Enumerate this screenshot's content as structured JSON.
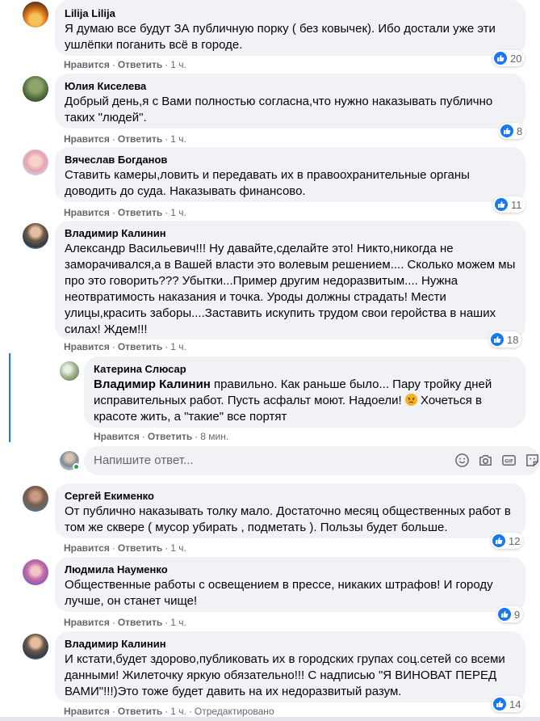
{
  "actions": {
    "like": "Нравится",
    "reply": "Ответить",
    "separator": "·"
  },
  "comments": [
    {
      "author": "Lilija Lilija",
      "lines": [
        "Я думаю все будут ЗА публичную порку ( без ковычек). Ибо достали уже эти",
        "ушлёпки поганить всё в городе."
      ],
      "time": "1 ч.",
      "likes": "20",
      "avatar": "sunset-avatar"
    },
    {
      "author": "Юлия Киселева",
      "lines": [
        "Добрый день,я с Вами полностью согласна,что нужно наказывать публично",
        "таких \"людей\"."
      ],
      "time": "1 ч.",
      "likes": "8",
      "avatar": "greenery-avatar"
    },
    {
      "author": "Вячеслав Богданов",
      "lines": [
        "Ставить камеры,ловить и передавать их в правоохранительные органы",
        "доводить до суда. Наказывать финансово."
      ],
      "time": "1 ч.",
      "likes": "11",
      "avatar": "flowers-avatar"
    },
    {
      "author": "Владимир Калинин",
      "lines": [
        "Александр Васильевич!!! Ну давайте,сделайте это! Никто,никогда не",
        "заморачивался,а в Вашей власти это волевым решением.... Сколько можем мы",
        "про это говорить??? Убытки...Пример другим недоразвитым.... Нужна",
        "неотвратимость наказания и точка. Уроды должны страдать! Мести",
        "улицы,красить заборы....Заставить искупить трудом свои геройства в наших",
        "силах! Ждем!!!"
      ],
      "time": "1 ч.",
      "likes": "18",
      "avatar": "man-suit-avatar"
    }
  ],
  "reply": {
    "author": "Катерина Слюсар",
    "mention": "Владимир Калинин",
    "line1_rest": " правильно. Как раньше было... Пару тройку дней",
    "lines": [
      "исправительных работ. Пусть асфальт моют. Надоели!",
      "красоте жить, а \"такие\" все портят"
    ],
    "line2_after_emoji": " Хочеться в",
    "time": "8 мин.",
    "emoji": "angry-face"
  },
  "reply_input": {
    "placeholder": "Напишите ответ..."
  },
  "comments2": [
    {
      "author": "Сергей Екименко",
      "lines": [
        "От публично наказывать толку мало. Достаточно месяц общественных работ в",
        "том же сквере ( мусор убирать , подметать ). Пользы будет больше."
      ],
      "time": "1 ч.",
      "likes": "12",
      "avatar": "group-avatar"
    },
    {
      "author": "Людмила Науменко",
      "lines": [
        "Общественные работы с освещением в прессе, никаких штрафов! И городу",
        "лучше, он станет чище!"
      ],
      "time": "1 ч.",
      "likes": "9",
      "avatar": "woman-avatar"
    },
    {
      "author": "Владимир Калинин",
      "lines": [
        "И кстати,будет здорово,публиковать их в городских групах соц.сетей со всеми",
        "данными! Жилеточку яркую обязательно!!! С надписью \"Я ВИНОВАТ ПЕРЕД",
        "ВАМИ\"!!!)Это тоже будет давить на их недоразвитый разум."
      ],
      "time": "1 ч.",
      "edited": "Отредактировано",
      "likes": "14",
      "avatar": "man-suit-avatar"
    }
  ],
  "colors": {
    "bubble": "#f0f2f5",
    "like_blue": "#1877f2",
    "meta": "#65676b"
  }
}
